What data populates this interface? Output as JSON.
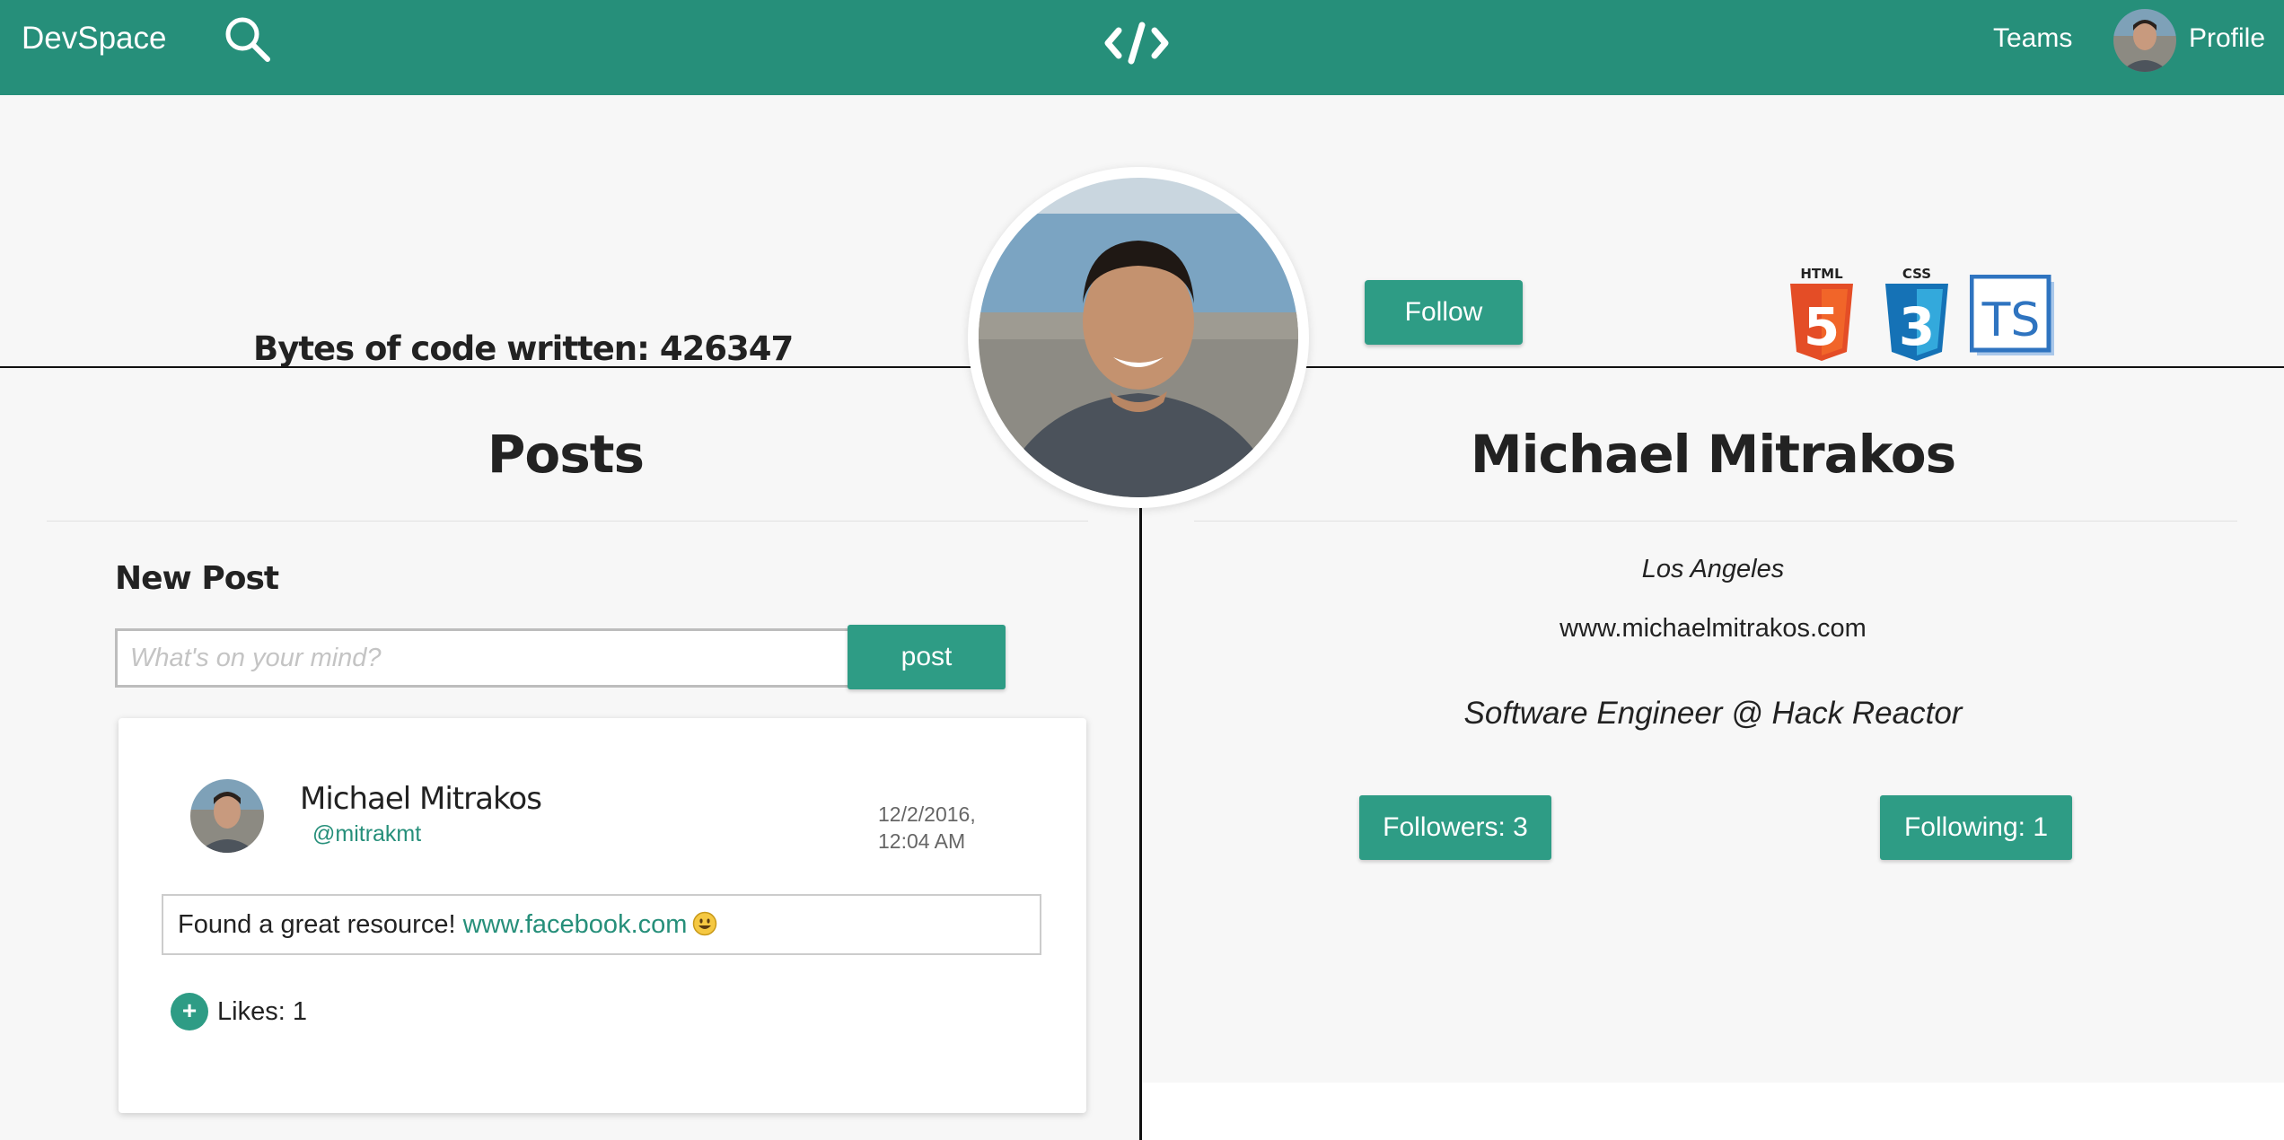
{
  "nav": {
    "brand": "DevSpace",
    "teams": "Teams",
    "profile": "Profile"
  },
  "icons": {
    "search": "search-icon",
    "code": "code-icon",
    "skills": [
      "html5-icon",
      "css3-icon",
      "typescript-icon"
    ]
  },
  "skills": {
    "html": "HTML",
    "html_num": "5",
    "css": "CSS",
    "css_num": "3",
    "ts": "TS"
  },
  "header": {
    "bytes": "Bytes of code written: 426347",
    "follow": "Follow"
  },
  "posts": {
    "title": "Posts",
    "new_post_label": "New Post",
    "input_placeholder": "What's on your mind?",
    "input_value": "",
    "post_button": "post",
    "items": [
      {
        "author": "Michael Mitrakos",
        "handle": "@mitrakmt",
        "date": "12/2/2016, 12:04 AM",
        "text": "Found a great resource! ",
        "link": "www.facebook.com",
        "emoji": "smiley-icon",
        "likes": "Likes: 1"
      }
    ]
  },
  "profile": {
    "name": "Michael Mitrakos",
    "location": "Los Angeles",
    "website": "www.michaelmitrakos.com",
    "tagline": "Software Engineer @ Hack Reactor",
    "followers": "Followers: 3",
    "following": "Following: 1"
  },
  "colors": {
    "primary": "#268f7a",
    "button": "#2e9c85",
    "background": "#f7f7f7"
  }
}
